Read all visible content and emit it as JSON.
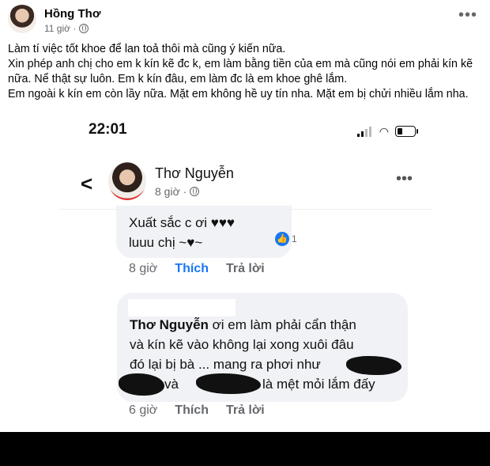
{
  "post": {
    "author": "Hồng Thơ",
    "time": "11 giờ ·",
    "caption": [
      "Làm tí việc tốt khoe để lan toả thôi mà cũng ý kiến nữa.",
      "Xin phép anh chị cho em k kín kẽ đc k, em làm bằng tiền của em mà cũng nói em phải kín kẽ",
      "nữa. Nể thật sự luôn. Em k kín đâu, em làm đc là em khoe ghê lắm.",
      "Em ngoài k kín em còn lầy nữa. Mặt em không hề uy tín nha. Mặt em bị chửi nhiều lắm nha."
    ]
  },
  "screenshot": {
    "clock": "22:01",
    "profile_name": "Thơ Nguyễn",
    "profile_time": "8 giờ ·",
    "comment1": {
      "line1": "Xuất sắc c ơi ♥♥♥",
      "line2": "luuu chị ~♥~",
      "reaction_count": "1",
      "time": "8 giờ",
      "like": "Thích",
      "reply": "Trả lời"
    },
    "comment2": {
      "mention": "Thơ Nguyễn",
      "line1_rest": " ơi em làm phải cẩn thận",
      "line2": "và kín kẽ vào không lại xong xuôi đâu",
      "line3": "đó lại bị bà ... mang ra phơi như",
      "line4_a": "và",
      "line4_b": "là mệt mỏi lắm đấy",
      "time": "6 giờ",
      "like": "Thích",
      "reply": "Trả lời"
    }
  },
  "colors": {
    "accent": "#1877f2",
    "secondary_text": "#65676b",
    "bubble": "#f0f2f5"
  },
  "icons": [
    "globe-icon",
    "more-icon",
    "back-icon",
    "signal-icon",
    "wifi-icon",
    "battery-icon",
    "like-reaction-icon"
  ]
}
